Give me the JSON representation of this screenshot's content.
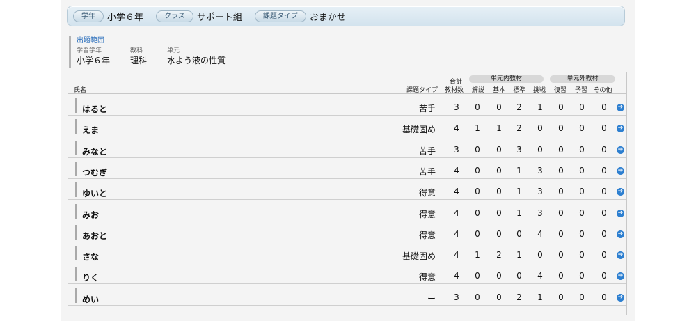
{
  "filters": [
    {
      "label": "学年",
      "value": "小学６年"
    },
    {
      "label": "クラス",
      "value": "サポート組"
    },
    {
      "label": "課題タイプ",
      "value": "おまかせ"
    }
  ],
  "scope": {
    "title": "出題範囲",
    "fields": [
      {
        "label": "学習学年",
        "value": "小学６年"
      },
      {
        "label": "教科",
        "value": "理科"
      },
      {
        "label": "単元",
        "value": "水よう液の性質"
      }
    ]
  },
  "table": {
    "headers": {
      "name": "氏名",
      "type": "課題タイプ",
      "total_top": "合計",
      "total_bottom": "教材数",
      "group_in": "単元内教材",
      "group_out": "単元外教材",
      "cols": [
        "解説",
        "基本",
        "標準",
        "挑戦",
        "復習",
        "予習",
        "その他"
      ]
    },
    "rows": [
      {
        "name": "はると",
        "type": "苦手",
        "total": "3",
        "vals": [
          "0",
          "0",
          "2",
          "1",
          "0",
          "0",
          "0"
        ]
      },
      {
        "name": "えま",
        "type": "基礎固め",
        "total": "4",
        "vals": [
          "1",
          "1",
          "2",
          "0",
          "0",
          "0",
          "0"
        ]
      },
      {
        "name": "みなと",
        "type": "苦手",
        "total": "3",
        "vals": [
          "0",
          "0",
          "3",
          "0",
          "0",
          "0",
          "0"
        ]
      },
      {
        "name": "つむぎ",
        "type": "苦手",
        "total": "4",
        "vals": [
          "0",
          "0",
          "1",
          "3",
          "0",
          "0",
          "0"
        ]
      },
      {
        "name": "ゆいと",
        "type": "得意",
        "total": "4",
        "vals": [
          "0",
          "0",
          "1",
          "3",
          "0",
          "0",
          "0"
        ]
      },
      {
        "name": "みお",
        "type": "得意",
        "total": "4",
        "vals": [
          "0",
          "0",
          "1",
          "3",
          "0",
          "0",
          "0"
        ]
      },
      {
        "name": "あおと",
        "type": "得意",
        "total": "4",
        "vals": [
          "0",
          "0",
          "0",
          "4",
          "0",
          "0",
          "0"
        ]
      },
      {
        "name": "さな",
        "type": "基礎固め",
        "total": "4",
        "vals": [
          "1",
          "2",
          "1",
          "0",
          "0",
          "0",
          "0"
        ]
      },
      {
        "name": "りく",
        "type": "得意",
        "total": "4",
        "vals": [
          "0",
          "0",
          "0",
          "4",
          "0",
          "0",
          "0"
        ]
      },
      {
        "name": "めい",
        "type": "ー",
        "total": "3",
        "vals": [
          "0",
          "0",
          "2",
          "1",
          "0",
          "0",
          "0"
        ]
      }
    ],
    "row_action_icon": "arrow-right-circle-icon"
  }
}
